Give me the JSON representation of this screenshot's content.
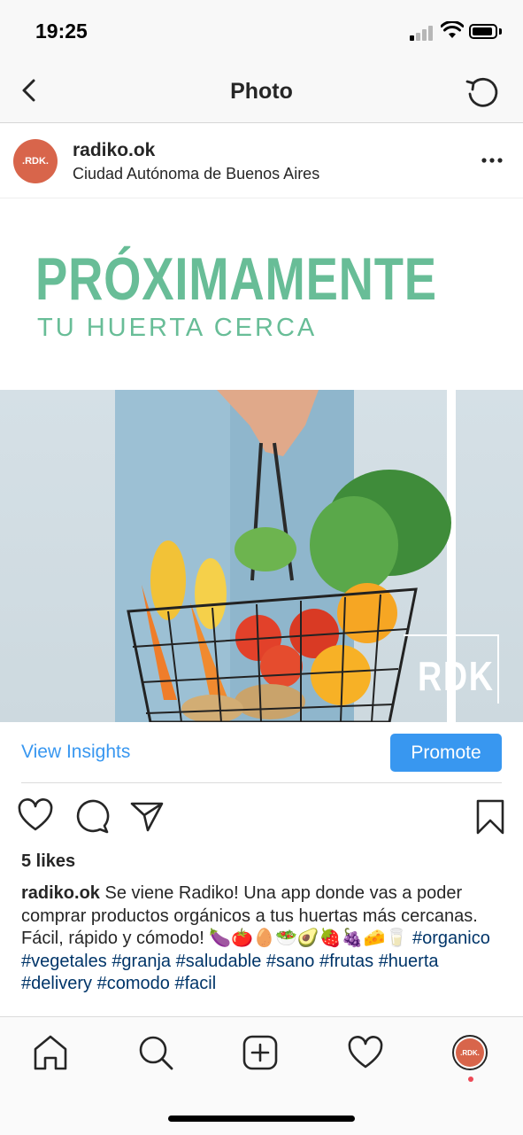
{
  "status_bar": {
    "time": "19:25"
  },
  "nav": {
    "title": "Photo"
  },
  "post": {
    "username": "radiko.ok",
    "location": "Ciudad Autónoma de Buenos Aires",
    "avatar_text": ".RDK.",
    "image": {
      "headline": "PRÓXIMAMENTE",
      "subheadline": "TU HUERTA CERCA",
      "watermark": "RDK"
    },
    "view_insights_label": "View Insights",
    "promote_label": "Promote",
    "likes": "5 likes",
    "caption": {
      "username": "radiko.ok",
      "text": "Se viene Radiko! Una app donde vas a poder comprar productos orgánicos a tus huertas más cercanas. Fácil, rápido y cómodo! 🍆🍅🥚🥗🥑🍓🍇🧀🥛",
      "hashtags": [
        "#organico",
        "#vegetales",
        "#granja",
        "#saludable",
        "#sano",
        "#frutas",
        "#huerta",
        "#delivery",
        "#comodo",
        "#facil"
      ]
    }
  },
  "tab_bar": {
    "items": [
      "home-icon",
      "search-icon",
      "add-icon",
      "activity-icon",
      "profile-avatar"
    ],
    "avatar_text": ".RDK."
  },
  "colors": {
    "accent": "#3897f0",
    "brand_green": "#68bd97",
    "brand_avatar": "#d8654b",
    "hashtag": "#003569"
  }
}
